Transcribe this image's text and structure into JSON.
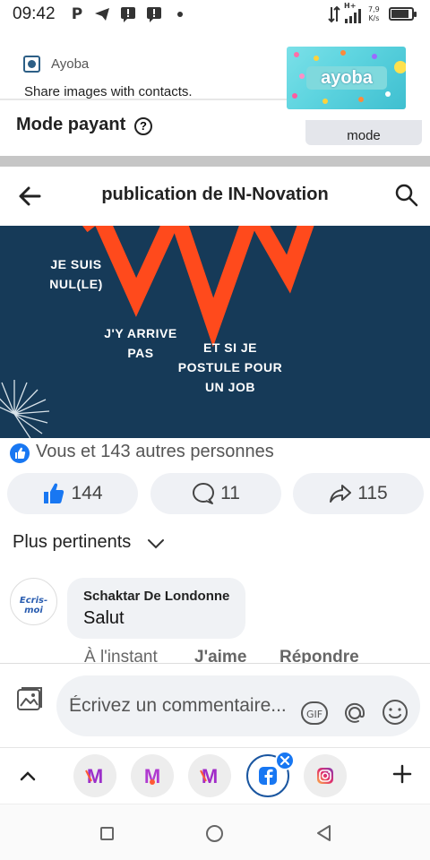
{
  "status_bar": {
    "time": "09:42",
    "icons": [
      "pinterest-icon",
      "telegram-icon",
      "message-alert-icon",
      "message-alert-icon",
      "dot-icon"
    ],
    "network": "H+",
    "speed_value": "7,9",
    "speed_unit": "K/s",
    "battery_level": 0.85
  },
  "notification": {
    "app_name": "Ayoba",
    "message": "Share images with contacts.",
    "banner_text": "ayoba"
  },
  "background_page": {
    "section_label": "Mode payant",
    "help_symbol": "?",
    "mode_button": "mode"
  },
  "header": {
    "title": "publication de IN-Novation"
  },
  "post_image": {
    "phrases": [
      "JE SUIS NUL(LE)",
      "J'Y ARRIVE PAS",
      "ET SI JE POSTULE POUR UN JOB"
    ],
    "accent_color": "#ff4a1c",
    "background_color": "#163a58"
  },
  "reactions": {
    "summary": "Vous et 143 autres personnes",
    "like_count": "144",
    "comment_count": "11",
    "share_count": "115"
  },
  "comments_section": {
    "sort_label": "Plus pertinents",
    "comment": {
      "avatar_text": "Ecris-moi",
      "author": "Schaktar De Londonne",
      "text": "Salut",
      "time": "À l'instant",
      "like_action": "J'aime",
      "reply_action": "Répondre"
    }
  },
  "composer": {
    "placeholder": "Écrivez un commentaire..."
  },
  "dock": {
    "apps": [
      "messenger-icon",
      "messenger-icon",
      "messenger-icon",
      "facebook-icon",
      "instagram-icon"
    ],
    "active_app": "facebook-icon"
  },
  "colors": {
    "brand_blue": "#1877f2",
    "pill_bg": "#eff1f5"
  }
}
